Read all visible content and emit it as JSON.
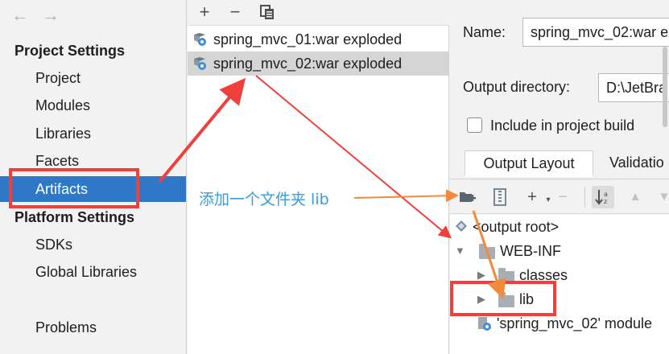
{
  "nav": {
    "back_icon": "back-arrow-icon",
    "forward_icon": "forward-arrow-icon"
  },
  "sidebar": {
    "project_settings_title": "Project Settings",
    "project_items": [
      {
        "label": "Project"
      },
      {
        "label": "Modules"
      },
      {
        "label": "Libraries"
      },
      {
        "label": "Facets"
      },
      {
        "label": "Artifacts",
        "selected": true
      }
    ],
    "platform_settings_title": "Platform Settings",
    "platform_items": [
      {
        "label": "SDKs"
      },
      {
        "label": "Global Libraries"
      }
    ],
    "problems_label": "Problems"
  },
  "artifacts_toolbar": {
    "add_symbol": "+",
    "remove_symbol": "−"
  },
  "artifacts": [
    {
      "name": "spring_mvc_01:war exploded",
      "selected": false
    },
    {
      "name": "spring_mvc_02:war exploded",
      "selected": true
    }
  ],
  "details": {
    "name_label": "Name:",
    "name_value": "spring_mvc_02:war e",
    "output_dir_label": "Output directory:",
    "output_dir_value": "D:\\JetBra",
    "include_label": "Include in project build",
    "include_checked": false,
    "tabs": [
      {
        "label": "Output Layout",
        "active": true
      },
      {
        "label": "Validatio",
        "active": false
      }
    ]
  },
  "layout_toolbar": {
    "add_symbol": "+",
    "remove_symbol": "−"
  },
  "tree": {
    "output_root": "<output root>",
    "web_inf": "WEB-INF",
    "classes": "classes",
    "lib": "lib",
    "module_output": "'spring_mvc_02' module"
  },
  "annotation": {
    "text": "添加一个文件夹 lib"
  },
  "colors": {
    "selection_blue": "#2f78c8",
    "highlight_red": "#f0403c",
    "annotation_blue": "#3a9bd9",
    "annotation_orange": "#f28a3c"
  }
}
